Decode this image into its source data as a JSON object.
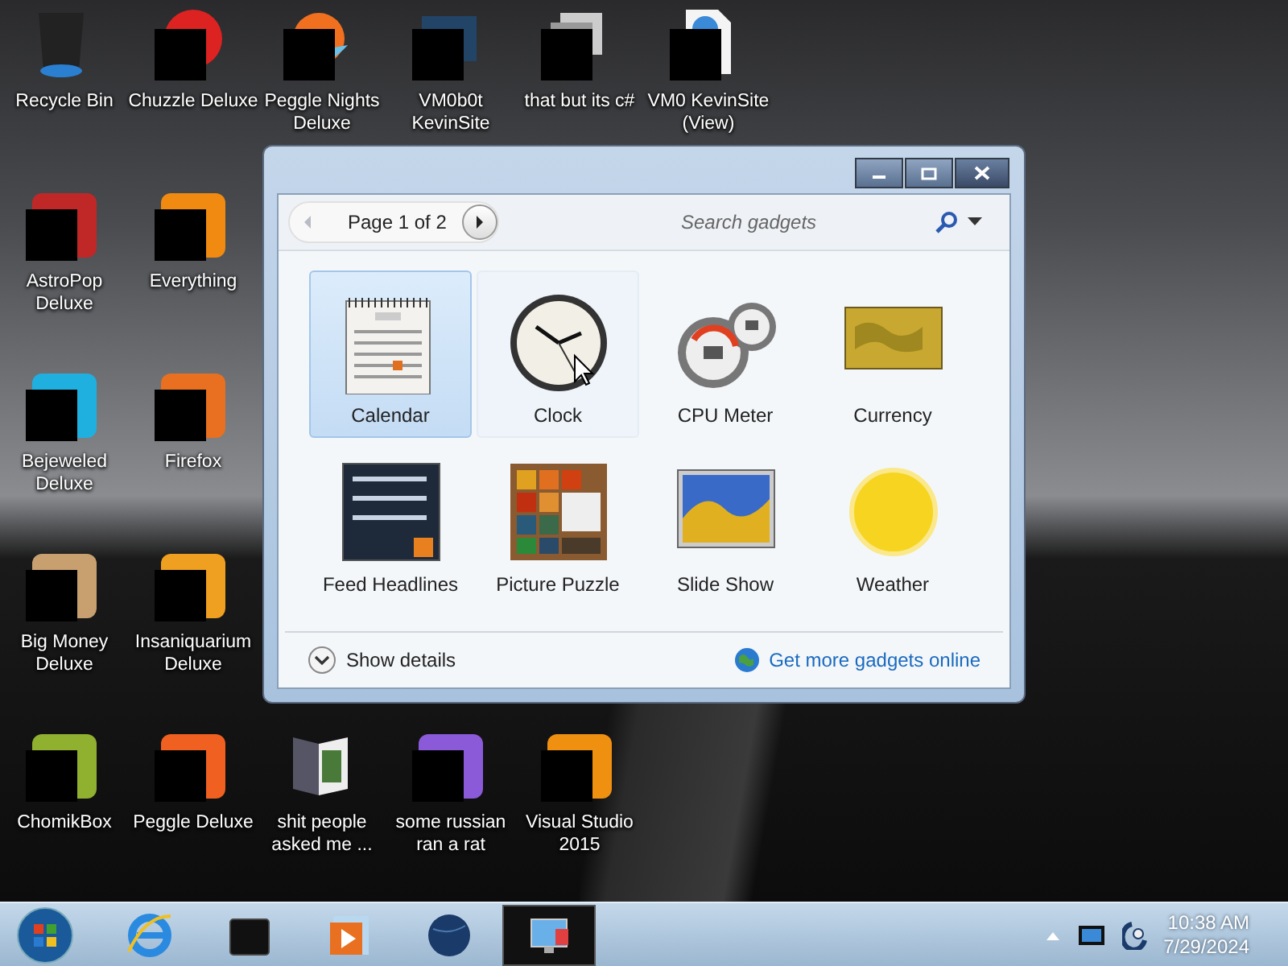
{
  "desktop_icons": [
    [
      {
        "label": "Recycle Bin",
        "redacted": false
      },
      {
        "label": "Chuzzle Deluxe",
        "redacted": true
      },
      {
        "label": "Peggle Nights Deluxe",
        "redacted": true
      },
      {
        "label": "VM0b0t KevinSite",
        "redacted": true
      },
      {
        "label": "that but its c#",
        "redacted": true
      },
      {
        "label": "VM0 KevinSite (View)",
        "redacted": true
      }
    ],
    [
      {
        "label": "AstroPop Deluxe",
        "redacted": true
      },
      {
        "label": "Everything",
        "redacted": true
      }
    ],
    [
      {
        "label": "Bejeweled Deluxe",
        "redacted": true
      },
      {
        "label": "Firefox",
        "redacted": true
      }
    ],
    [
      {
        "label": "Big Money Deluxe",
        "redacted": true
      },
      {
        "label": "Insaniquarium Deluxe",
        "redacted": true
      }
    ],
    [
      {
        "label": "ChomikBox",
        "redacted": true
      },
      {
        "label": "Peggle Deluxe",
        "redacted": true
      },
      {
        "label": "shit people asked me ...",
        "redacted": false
      },
      {
        "label": "some russian ran a rat",
        "redacted": true
      },
      {
        "label": "Visual Studio 2015",
        "redacted": true
      }
    ]
  ],
  "gadget_window": {
    "page": "Page 1 of 2",
    "back_disabled": true,
    "search": {
      "placeholder": "Search gadgets"
    },
    "gadgets": [
      {
        "label": "Calendar",
        "selected": true,
        "hovered": false
      },
      {
        "label": "Clock",
        "selected": false,
        "hovered": true
      },
      {
        "label": "CPU Meter",
        "selected": false,
        "hovered": false
      },
      {
        "label": "Currency",
        "selected": false,
        "hovered": false
      },
      {
        "label": "Feed Headlines",
        "selected": false,
        "hovered": false
      },
      {
        "label": "Picture Puzzle",
        "selected": false,
        "hovered": false
      },
      {
        "label": "Slide Show",
        "selected": false,
        "hovered": false
      },
      {
        "label": "Weather",
        "selected": false,
        "hovered": false
      }
    ],
    "details_button": "Show details",
    "online_link": "Get more gadgets online"
  },
  "taskbar": {
    "items": [
      {
        "active": false
      },
      {
        "active": false
      },
      {
        "active": false
      },
      {
        "active": false
      },
      {
        "active": true
      }
    ],
    "clock": {
      "time": "10:38 AM",
      "date": "7/29/2024"
    }
  }
}
